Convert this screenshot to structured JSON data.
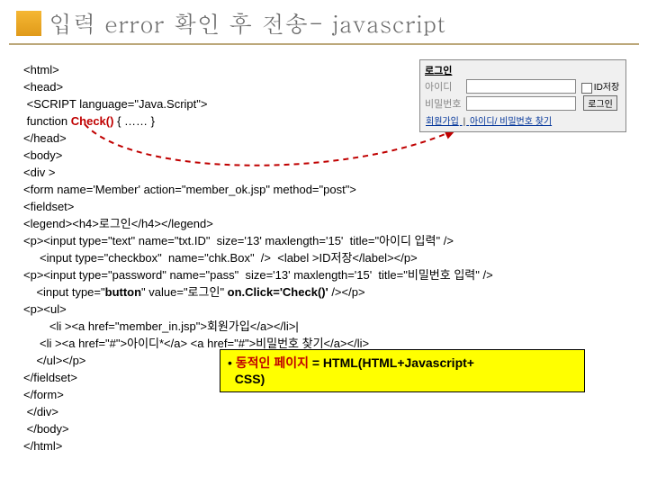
{
  "title": "입력 error 확인 후 전송- javascript",
  "login": {
    "legend": "로그인",
    "id_label": "아이디",
    "pw_label": "비밀번호",
    "save_id": "ID저장",
    "submit": "로그인",
    "link_join": "회원가입",
    "link_find": "아이디/ 비밀번호 찾기",
    "sep": "|"
  },
  "code": {
    "l1": "<html>",
    "l2": "<head>",
    "l3": " <SCRIPT language=\"Java.Script\">",
    "l4a": " function ",
    "l4b": "Check()",
    "l4c": " { …… }",
    "l5": "</head>",
    "l6": "<body>",
    "l7": "<div >",
    "l8": "<form name='Member' action=\"member_ok.jsp\" method=\"post\">",
    "l9": "<fieldset>",
    "l10": "<legend><h4>로그인</h4></legend>",
    "l11": "<p><input type=\"text\" name=\"txt.ID\"  size='13' maxlength='15'  title=\"아이디 입력\" />",
    "l12": "     <input type=\"checkbox\"  name=\"chk.Box\"  />  <label >ID저장</label></p>",
    "l13": "<p><input type=\"password\" name=\"pass\"  size='13' maxlength='15'  title=\"비밀번호 입력\" />",
    "l14a": "    <input type=\"",
    "l14b": "button",
    "l14c": "\" value=\"로그인\" ",
    "l14d": "on.Click='Check()'",
    "l14e": " /></p>",
    "l15": "<p><ul>",
    "l16": "        <li ><a href=\"member_in.jsp\">회원가입</a></li>|",
    "l17": "     <li ><a href=\"#\">아이디*</a> <a href=\"#\">비밀번호 찾기</a></li>",
    "l18": "    </ul></p>",
    "l19": "</fieldset>",
    "l20": "</form>",
    "l21": " </div>",
    "l22": " </body>",
    "l23": "</html>"
  },
  "callout": {
    "bullet": "• ",
    "red": "동적인 페이지 ",
    "rest1": " = HTML(HTML+Javascript+",
    "rest2": "CSS)"
  }
}
